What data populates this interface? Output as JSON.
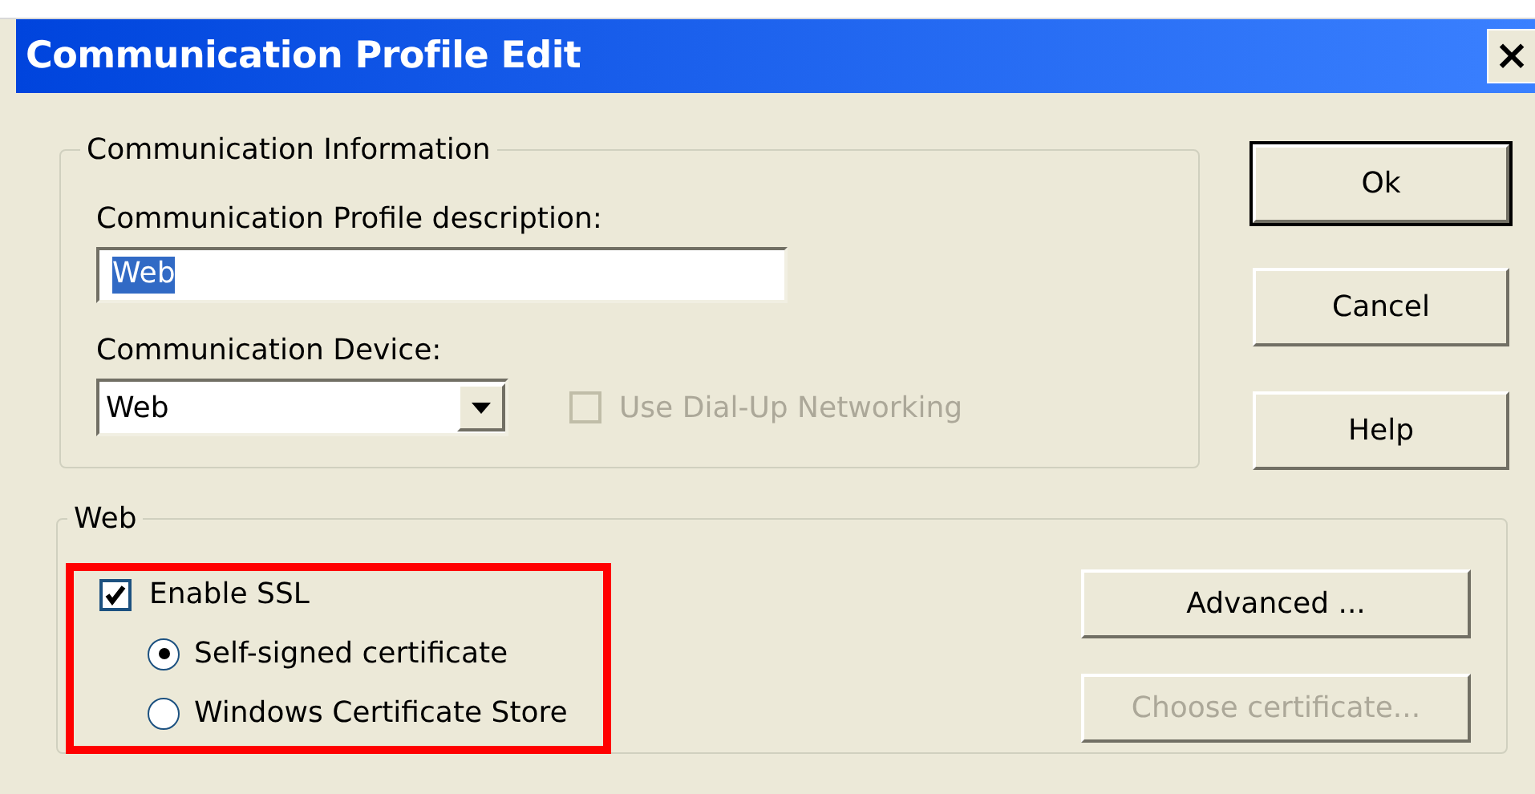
{
  "window": {
    "title": "Communication Profile Edit",
    "close": "×"
  },
  "communication_information": {
    "title": "Communication Information",
    "description_label": "Communication Profile description:",
    "description_value": "Web",
    "description_selected": true,
    "device_label": "Communication Device:",
    "device_value": "Web",
    "dialup": {
      "label": "Use Dial-Up Networking",
      "checked": false,
      "disabled": true
    }
  },
  "buttons": [
    {
      "label": "Ok",
      "default": true
    },
    {
      "label": "Cancel",
      "default": false
    },
    {
      "label": "Help",
      "default": false
    }
  ],
  "web": {
    "title": "Web",
    "enable_ssl": {
      "label": "Enable SSL",
      "checked": true
    },
    "certificates": [
      {
        "label": "Self-signed certificate",
        "selected": true
      },
      {
        "label": "Windows Certificate Store",
        "selected": false
      }
    ],
    "actions": [
      {
        "label": "Advanced ...",
        "disabled": false
      },
      {
        "label": "Choose certificate...",
        "disabled": true
      }
    ]
  }
}
